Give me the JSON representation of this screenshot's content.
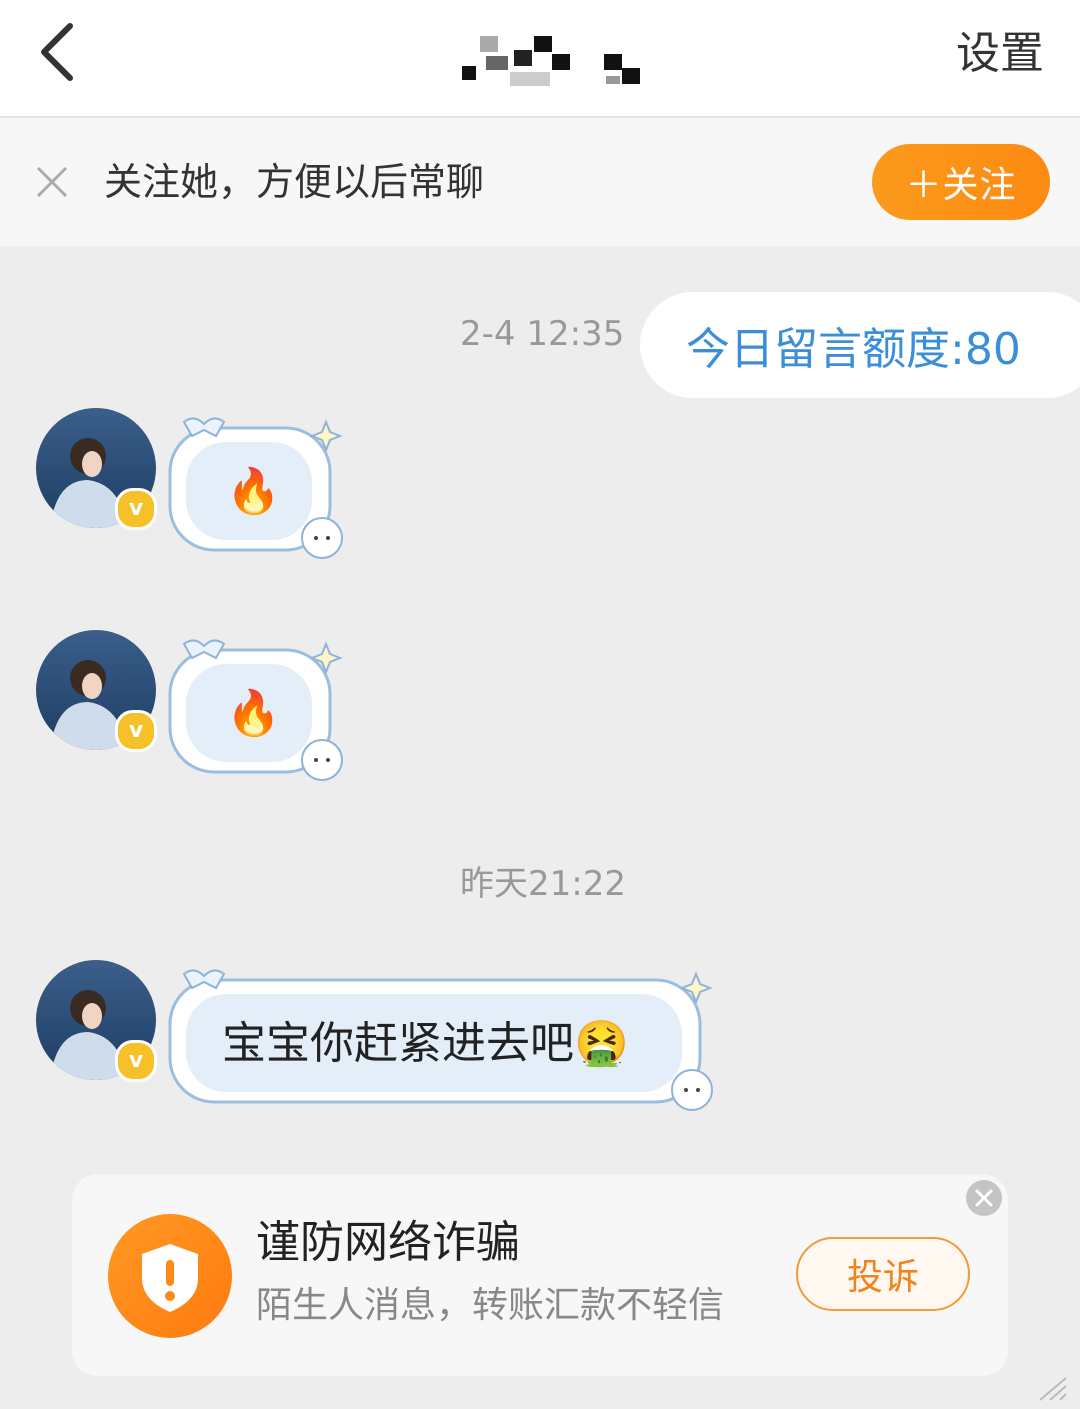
{
  "header": {
    "back_icon": "chevron-left-icon",
    "title_icon": "pixelated-name",
    "settings_label": "设置"
  },
  "follow_bar": {
    "close_icon": "close-icon",
    "text": "关注她，方便以后常聊",
    "button_label": "＋关注",
    "button_color": "#fd8f17"
  },
  "messages": [
    {
      "time": "2-4 12:35"
    },
    {
      "quota_text": "今日留言额度:80"
    },
    {
      "sender": "other",
      "content": "🔥",
      "badge": "v"
    },
    {
      "sender": "other",
      "content": "🔥",
      "badge": "v"
    },
    {
      "time": "昨天21:22"
    },
    {
      "sender": "other",
      "content": "宝宝你赶紧进去吧🤮",
      "badge": "v"
    }
  ],
  "warning": {
    "icon": "shield-exclamation-icon",
    "title": "谨防网络诈骗",
    "subtitle": "陌生人消息，转账汇款不轻信",
    "report_label": "投诉",
    "close_icon": "close-circle-icon",
    "accent": "#ff8a1a"
  },
  "colors": {
    "background": "#ededed",
    "quota_text": "#3b8ed8",
    "bubble_fill": "#e3eef9"
  }
}
